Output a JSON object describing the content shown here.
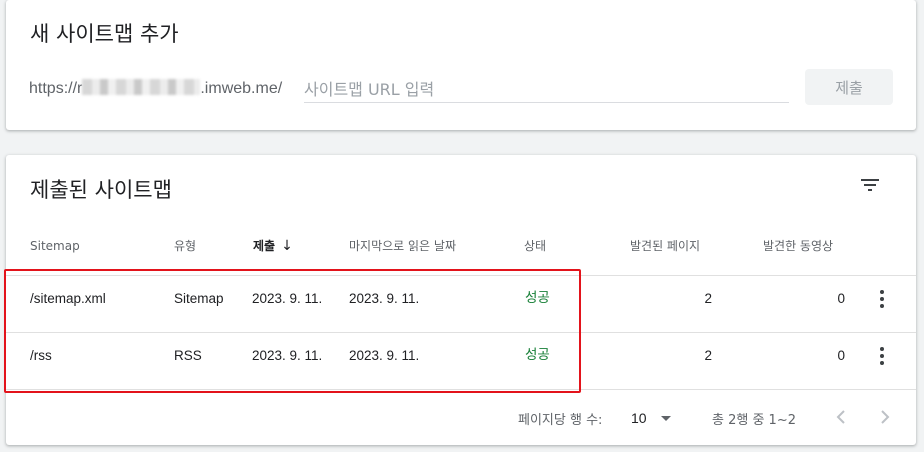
{
  "add_sitemap": {
    "title": "새 사이트맵 추가",
    "url_prefix_start": "https://r",
    "url_prefix_end": ".imweb.me/",
    "input_placeholder": "사이트맵 URL 입력",
    "input_value": "",
    "submit_label": "제출"
  },
  "submitted": {
    "title": "제출된 사이트맵",
    "filter_icon": "filter-list-icon",
    "columns": {
      "sitemap": "Sitemap",
      "type": "유형",
      "submitted": "제출",
      "last_read": "마지막으로 읽은 날짜",
      "status": "상태",
      "pages": "발견된 페이지",
      "videos": "발견한 동영상"
    },
    "sort_icon": "arrow-downward-icon",
    "rows": [
      {
        "sitemap": "/sitemap.xml",
        "type": "Sitemap",
        "submitted": "2023. 9. 11.",
        "last_read": "2023. 9. 11.",
        "status": "성공",
        "pages": "2",
        "videos": "0"
      },
      {
        "sitemap": "/rss",
        "type": "RSS",
        "submitted": "2023. 9. 11.",
        "last_read": "2023. 9. 11.",
        "status": "성공",
        "pages": "2",
        "videos": "0"
      }
    ],
    "pagination": {
      "rows_per_page_label": "페이지당 행 수:",
      "rows_per_page_value": "10",
      "range_text": "총 2행 중 1~2"
    }
  },
  "colors": {
    "success": "#188038",
    "highlight_border": "#e3131b"
  }
}
